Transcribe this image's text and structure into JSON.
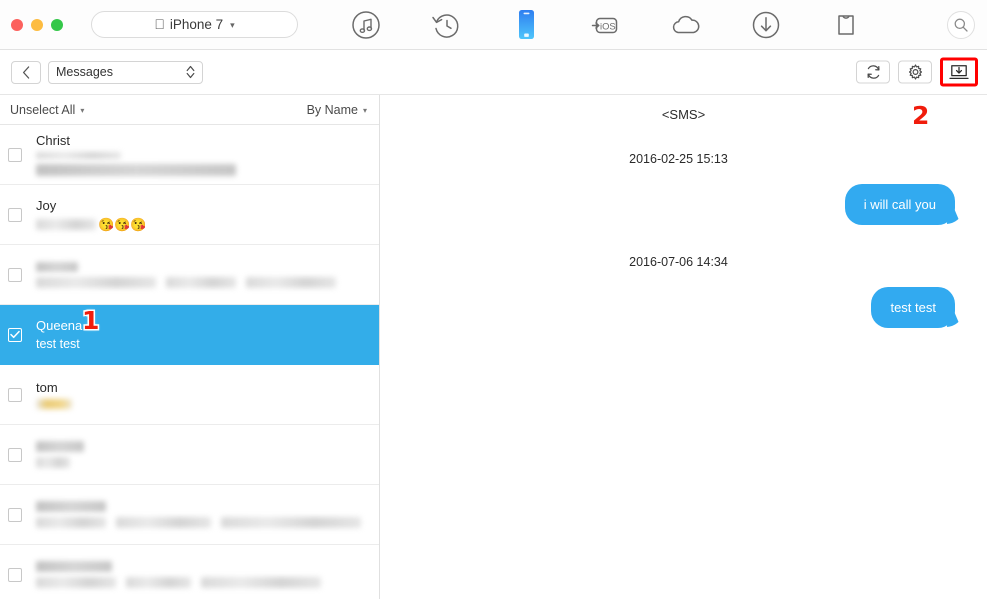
{
  "window": {
    "traffic_lights": [
      "close",
      "minimize",
      "zoom"
    ],
    "colors": {
      "close": "#fc615d",
      "minimize": "#fdbc40",
      "zoom": "#34c749",
      "accent_blue": "#33ade9",
      "bubble_blue": "#32aaf0",
      "annotation_red": "#f01c0c",
      "device_icon_blue": "#3aa8f5"
    }
  },
  "toolbar": {
    "device_label": "iPhone 7",
    "device_caret": "⌄",
    "apple_glyph": "",
    "icons": [
      {
        "name": "music-icon",
        "label": "Music"
      },
      {
        "name": "history-icon",
        "label": "History"
      },
      {
        "name": "device-icon",
        "label": "Device"
      },
      {
        "name": "to-ios-icon",
        "label": "To iOS"
      },
      {
        "name": "cloud-icon",
        "label": "iCloud"
      },
      {
        "name": "download-icon",
        "label": "Download"
      },
      {
        "name": "toolkit-icon",
        "label": "Toolkit"
      }
    ],
    "search_icon": "search-icon"
  },
  "subtoolbar": {
    "back_label": "‹",
    "section": "Messages",
    "updown_glyph": "⌃⌄",
    "refresh_label": "Refresh",
    "settings_label": "Settings",
    "export_label": "Export"
  },
  "list_header": {
    "select_label": "Unselect All",
    "sort_label": "By Name",
    "caret": "▾"
  },
  "conversations": [
    {
      "name": "Christ",
      "preview": "",
      "checked": false,
      "selected": false,
      "redacted": true,
      "emojis": ""
    },
    {
      "name": "Joy",
      "preview": "",
      "checked": false,
      "selected": false,
      "redacted": true,
      "emojis": "😘😘😘"
    },
    {
      "name": "",
      "preview": "",
      "checked": false,
      "selected": false,
      "redacted": true,
      "emojis": ""
    },
    {
      "name": "Queena",
      "preview": "test test",
      "checked": true,
      "selected": true,
      "redacted": false,
      "emojis": ""
    },
    {
      "name": "tom",
      "preview": "",
      "checked": false,
      "selected": false,
      "redacted": true,
      "emojis": ""
    },
    {
      "name": "",
      "preview": "",
      "checked": false,
      "selected": false,
      "redacted": true,
      "emojis": ""
    },
    {
      "name": "",
      "preview": "",
      "checked": false,
      "selected": false,
      "redacted": true,
      "emojis": ""
    },
    {
      "name": "",
      "preview": "",
      "checked": false,
      "selected": false,
      "redacted": true,
      "emojis": ""
    }
  ],
  "thread": {
    "title": "<SMS>",
    "messages": [
      {
        "timestamp": "2016-02-25 15:13",
        "text": "i will call you",
        "outgoing": true
      },
      {
        "timestamp": "2016-07-06 14:34",
        "text": "test test",
        "outgoing": true
      }
    ]
  },
  "annotations": [
    {
      "id": "1",
      "text": "1"
    },
    {
      "id": "2",
      "text": "2"
    }
  ]
}
